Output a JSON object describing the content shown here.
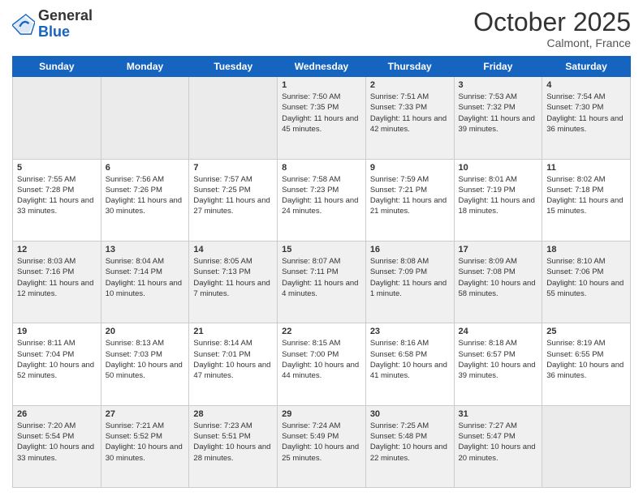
{
  "logo": {
    "general": "General",
    "blue": "Blue"
  },
  "title": "October 2025",
  "location": "Calmont, France",
  "days_header": [
    "Sunday",
    "Monday",
    "Tuesday",
    "Wednesday",
    "Thursday",
    "Friday",
    "Saturday"
  ],
  "weeks": [
    [
      {
        "day": "",
        "info": ""
      },
      {
        "day": "",
        "info": ""
      },
      {
        "day": "",
        "info": ""
      },
      {
        "day": "1",
        "info": "Sunrise: 7:50 AM\nSunset: 7:35 PM\nDaylight: 11 hours and 45 minutes."
      },
      {
        "day": "2",
        "info": "Sunrise: 7:51 AM\nSunset: 7:33 PM\nDaylight: 11 hours and 42 minutes."
      },
      {
        "day": "3",
        "info": "Sunrise: 7:53 AM\nSunset: 7:32 PM\nDaylight: 11 hours and 39 minutes."
      },
      {
        "day": "4",
        "info": "Sunrise: 7:54 AM\nSunset: 7:30 PM\nDaylight: 11 hours and 36 minutes."
      }
    ],
    [
      {
        "day": "5",
        "info": "Sunrise: 7:55 AM\nSunset: 7:28 PM\nDaylight: 11 hours and 33 minutes."
      },
      {
        "day": "6",
        "info": "Sunrise: 7:56 AM\nSunset: 7:26 PM\nDaylight: 11 hours and 30 minutes."
      },
      {
        "day": "7",
        "info": "Sunrise: 7:57 AM\nSunset: 7:25 PM\nDaylight: 11 hours and 27 minutes."
      },
      {
        "day": "8",
        "info": "Sunrise: 7:58 AM\nSunset: 7:23 PM\nDaylight: 11 hours and 24 minutes."
      },
      {
        "day": "9",
        "info": "Sunrise: 7:59 AM\nSunset: 7:21 PM\nDaylight: 11 hours and 21 minutes."
      },
      {
        "day": "10",
        "info": "Sunrise: 8:01 AM\nSunset: 7:19 PM\nDaylight: 11 hours and 18 minutes."
      },
      {
        "day": "11",
        "info": "Sunrise: 8:02 AM\nSunset: 7:18 PM\nDaylight: 11 hours and 15 minutes."
      }
    ],
    [
      {
        "day": "12",
        "info": "Sunrise: 8:03 AM\nSunset: 7:16 PM\nDaylight: 11 hours and 12 minutes."
      },
      {
        "day": "13",
        "info": "Sunrise: 8:04 AM\nSunset: 7:14 PM\nDaylight: 11 hours and 10 minutes."
      },
      {
        "day": "14",
        "info": "Sunrise: 8:05 AM\nSunset: 7:13 PM\nDaylight: 11 hours and 7 minutes."
      },
      {
        "day": "15",
        "info": "Sunrise: 8:07 AM\nSunset: 7:11 PM\nDaylight: 11 hours and 4 minutes."
      },
      {
        "day": "16",
        "info": "Sunrise: 8:08 AM\nSunset: 7:09 PM\nDaylight: 11 hours and 1 minute."
      },
      {
        "day": "17",
        "info": "Sunrise: 8:09 AM\nSunset: 7:08 PM\nDaylight: 10 hours and 58 minutes."
      },
      {
        "day": "18",
        "info": "Sunrise: 8:10 AM\nSunset: 7:06 PM\nDaylight: 10 hours and 55 minutes."
      }
    ],
    [
      {
        "day": "19",
        "info": "Sunrise: 8:11 AM\nSunset: 7:04 PM\nDaylight: 10 hours and 52 minutes."
      },
      {
        "day": "20",
        "info": "Sunrise: 8:13 AM\nSunset: 7:03 PM\nDaylight: 10 hours and 50 minutes."
      },
      {
        "day": "21",
        "info": "Sunrise: 8:14 AM\nSunset: 7:01 PM\nDaylight: 10 hours and 47 minutes."
      },
      {
        "day": "22",
        "info": "Sunrise: 8:15 AM\nSunset: 7:00 PM\nDaylight: 10 hours and 44 minutes."
      },
      {
        "day": "23",
        "info": "Sunrise: 8:16 AM\nSunset: 6:58 PM\nDaylight: 10 hours and 41 minutes."
      },
      {
        "day": "24",
        "info": "Sunrise: 8:18 AM\nSunset: 6:57 PM\nDaylight: 10 hours and 39 minutes."
      },
      {
        "day": "25",
        "info": "Sunrise: 8:19 AM\nSunset: 6:55 PM\nDaylight: 10 hours and 36 minutes."
      }
    ],
    [
      {
        "day": "26",
        "info": "Sunrise: 7:20 AM\nSunset: 5:54 PM\nDaylight: 10 hours and 33 minutes."
      },
      {
        "day": "27",
        "info": "Sunrise: 7:21 AM\nSunset: 5:52 PM\nDaylight: 10 hours and 30 minutes."
      },
      {
        "day": "28",
        "info": "Sunrise: 7:23 AM\nSunset: 5:51 PM\nDaylight: 10 hours and 28 minutes."
      },
      {
        "day": "29",
        "info": "Sunrise: 7:24 AM\nSunset: 5:49 PM\nDaylight: 10 hours and 25 minutes."
      },
      {
        "day": "30",
        "info": "Sunrise: 7:25 AM\nSunset: 5:48 PM\nDaylight: 10 hours and 22 minutes."
      },
      {
        "day": "31",
        "info": "Sunrise: 7:27 AM\nSunset: 5:47 PM\nDaylight: 10 hours and 20 minutes."
      },
      {
        "day": "",
        "info": ""
      }
    ]
  ]
}
